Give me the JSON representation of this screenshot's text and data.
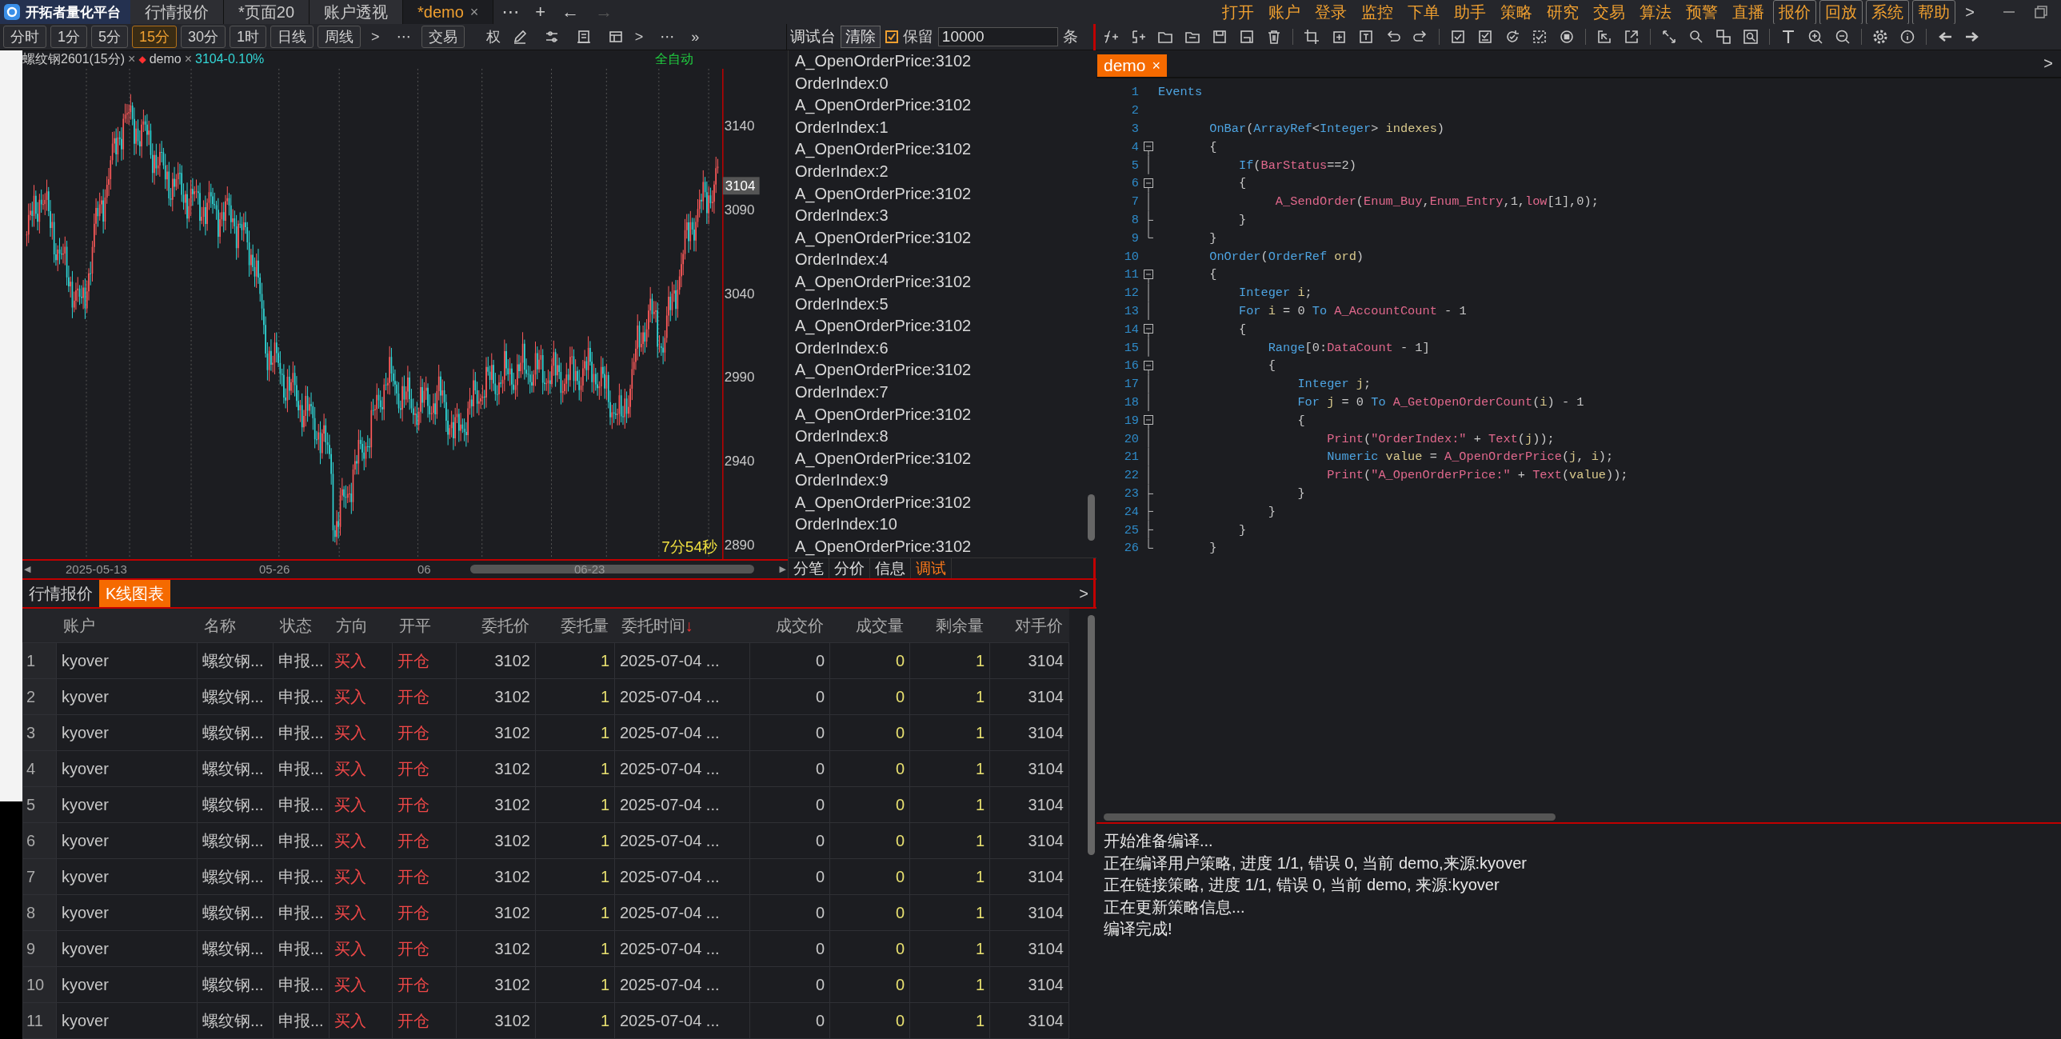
{
  "top_bar": {
    "logo": "开拓者量化平台",
    "tabs": [
      {
        "label": "行情报价",
        "selected": false
      },
      {
        "label": "*页面20",
        "selected": false
      },
      {
        "label": "账户透视",
        "selected": false
      },
      {
        "label": "*demo",
        "selected": true,
        "close": "×"
      }
    ],
    "tab_actions": [
      {
        "label": "⋯",
        "disabled": false
      },
      {
        "label": "+",
        "disabled": false
      },
      {
        "label": "←",
        "disabled": false
      },
      {
        "label": "→",
        "disabled": true
      }
    ],
    "menu": [
      {
        "label": "打开",
        "boxed": false
      },
      {
        "label": "账户",
        "boxed": false
      },
      {
        "label": "登录",
        "boxed": false
      },
      {
        "label": "监控",
        "boxed": false
      },
      {
        "label": "下单",
        "boxed": false
      },
      {
        "label": "助手",
        "boxed": false
      },
      {
        "label": "策略",
        "boxed": false
      },
      {
        "label": "研究",
        "boxed": false
      },
      {
        "label": "交易",
        "boxed": false
      },
      {
        "label": "算法",
        "boxed": false
      },
      {
        "label": "预警",
        "boxed": false
      },
      {
        "label": "直播",
        "boxed": false
      },
      {
        "label": "报价",
        "boxed": true
      },
      {
        "label": "回放",
        "boxed": true
      },
      {
        "label": "系统",
        "boxed": true
      },
      {
        "label": "帮助",
        "boxed": true
      }
    ],
    "menu_more": ">"
  },
  "chart_toolbar": {
    "periods": [
      {
        "label": "分时",
        "selected": false
      },
      {
        "label": "1分",
        "selected": false
      },
      {
        "label": "5分",
        "selected": false
      },
      {
        "label": "15分",
        "selected": true
      },
      {
        "label": "30分",
        "selected": false
      },
      {
        "label": "1时",
        "selected": false
      },
      {
        "label": "日线",
        "selected": false
      },
      {
        "label": "周线",
        "selected": false
      }
    ],
    "next": ">",
    "more": "⋯",
    "trade": "交易",
    "rights": "权",
    "next_2": ">",
    "more_2": "⋯",
    "expand": "»"
  },
  "chart": {
    "symbol": "螺纹钢2601(15分)",
    "close": "×",
    "strategy_mark": "◆",
    "strategy": "demo",
    "close_2": "×",
    "quote": "3104-0.10%",
    "mode": "全自动",
    "price_ticks": [
      "3140",
      "3090",
      "3040",
      "2990",
      "2940",
      "2890"
    ],
    "last_price": "3104",
    "countdown": "7分54秒",
    "scroll_left": "◀",
    "scroll_right": "▶",
    "date_ticks": [
      "2025-05-13",
      "05-26",
      "06",
      "06-23"
    ]
  },
  "debug": {
    "title": "调试台",
    "clear": "清除",
    "keep": {
      "label": "保留",
      "checked": true
    },
    "limit": "10000",
    "unit": "条",
    "lines": [
      "A_OpenOrderPrice:3102",
      "OrderIndex:0",
      "A_OpenOrderPrice:3102",
      "OrderIndex:1",
      "A_OpenOrderPrice:3102",
      "OrderIndex:2",
      "A_OpenOrderPrice:3102",
      "OrderIndex:3",
      "A_OpenOrderPrice:3102",
      "OrderIndex:4",
      "A_OpenOrderPrice:3102",
      "OrderIndex:5",
      "A_OpenOrderPrice:3102",
      "OrderIndex:6",
      "A_OpenOrderPrice:3102",
      "OrderIndex:7",
      "A_OpenOrderPrice:3102",
      "OrderIndex:8",
      "A_OpenOrderPrice:3102",
      "OrderIndex:9",
      "A_OpenOrderPrice:3102",
      "OrderIndex:10",
      "A_OpenOrderPrice:3102"
    ],
    "tabs": [
      {
        "label": "分笔",
        "selected": false
      },
      {
        "label": "分价",
        "selected": false
      },
      {
        "label": "信息",
        "selected": false
      },
      {
        "label": "调试",
        "selected": true
      }
    ]
  },
  "orders_panel": {
    "tabs": [
      {
        "label": "行情报价",
        "selected": false
      },
      {
        "label": "K线图表",
        "selected": true
      }
    ],
    "more": ">",
    "columns": [
      {
        "label": "账户",
        "color": "#c8c8c8"
      },
      {
        "label": "名称",
        "color": "#c8c8c8"
      },
      {
        "label": "状态",
        "color": "#c8c8c8"
      },
      {
        "label": "方向",
        "color": "#f04848"
      },
      {
        "label": "开平",
        "color": "#f04848"
      },
      {
        "label": "委托价",
        "color": "#c8c8c8"
      },
      {
        "label": "委托量",
        "color": "#e8e070"
      },
      {
        "label": "委托时间",
        "sort_mark": "↓",
        "color": "#c8c8c8"
      },
      {
        "label": "成交价",
        "color": "#c8c8c8"
      },
      {
        "label": "成交量",
        "color": "#e8e070"
      },
      {
        "label": "剩余量",
        "color": "#e8e070"
      },
      {
        "label": "对手价",
        "color": "#c8c8c8"
      }
    ],
    "rows": [
      {
        "index": "1",
        "cells": [
          "kyover",
          "螺纹钢...",
          "申报...",
          "买入",
          "开仓",
          "3102",
          "1",
          "2025-07-04 ...",
          "0",
          "0",
          "1",
          "3104"
        ]
      },
      {
        "index": "2",
        "cells": [
          "kyover",
          "螺纹钢...",
          "申报...",
          "买入",
          "开仓",
          "3102",
          "1",
          "2025-07-04 ...",
          "0",
          "0",
          "1",
          "3104"
        ]
      },
      {
        "index": "3",
        "cells": [
          "kyover",
          "螺纹钢...",
          "申报...",
          "买入",
          "开仓",
          "3102",
          "1",
          "2025-07-04 ...",
          "0",
          "0",
          "1",
          "3104"
        ]
      },
      {
        "index": "4",
        "cells": [
          "kyover",
          "螺纹钢...",
          "申报...",
          "买入",
          "开仓",
          "3102",
          "1",
          "2025-07-04 ...",
          "0",
          "0",
          "1",
          "3104"
        ]
      },
      {
        "index": "5",
        "cells": [
          "kyover",
          "螺纹钢...",
          "申报...",
          "买入",
          "开仓",
          "3102",
          "1",
          "2025-07-04 ...",
          "0",
          "0",
          "1",
          "3104"
        ]
      },
      {
        "index": "6",
        "cells": [
          "kyover",
          "螺纹钢...",
          "申报...",
          "买入",
          "开仓",
          "3102",
          "1",
          "2025-07-04 ...",
          "0",
          "0",
          "1",
          "3104"
        ]
      },
      {
        "index": "7",
        "cells": [
          "kyover",
          "螺纹钢...",
          "申报...",
          "买入",
          "开仓",
          "3102",
          "1",
          "2025-07-04 ...",
          "0",
          "0",
          "1",
          "3104"
        ]
      },
      {
        "index": "8",
        "cells": [
          "kyover",
          "螺纹钢...",
          "申报...",
          "买入",
          "开仓",
          "3102",
          "1",
          "2025-07-04 ...",
          "0",
          "0",
          "1",
          "3104"
        ]
      },
      {
        "index": "9",
        "cells": [
          "kyover",
          "螺纹钢...",
          "申报...",
          "买入",
          "开仓",
          "3102",
          "1",
          "2025-07-04 ...",
          "0",
          "0",
          "1",
          "3104"
        ]
      },
      {
        "index": "10",
        "cells": [
          "kyover",
          "螺纹钢...",
          "申报...",
          "买入",
          "开仓",
          "3102",
          "1",
          "2025-07-04 ...",
          "0",
          "0",
          "1",
          "3104"
        ]
      },
      {
        "index": "11",
        "cells": [
          "kyover",
          "螺纹钢...",
          "申报...",
          "买入",
          "开仓",
          "3102",
          "1",
          "2025-07-04 ...",
          "0",
          "0",
          "1",
          "3104"
        ]
      }
    ]
  },
  "editor": {
    "tab": {
      "label": "demo",
      "close": "×"
    },
    "more": ">",
    "lines": [
      {
        "number": "1",
        "kind": "none",
        "tokens": [
          {
            "text": "Events",
            "kind": "kw"
          }
        ]
      },
      {
        "number": "2",
        "kind": "none"
      },
      {
        "number": "3",
        "kind": "none",
        "tokens": [
          {
            "text": "       OnBar",
            "kind": "kw"
          },
          {
            "text": "(",
            "kind": "p"
          },
          {
            "text": "ArrayRef",
            "kind": "kw"
          },
          {
            "text": "<",
            "kind": "p"
          },
          {
            "text": "Integer",
            "kind": "kw"
          },
          {
            "text": "> ",
            "kind": "p"
          },
          {
            "text": "indexes",
            "kind": "var"
          },
          {
            "text": ")",
            "kind": "p"
          }
        ]
      },
      {
        "number": "4",
        "kind": "start",
        "tokens": [
          {
            "text": "       {",
            "kind": "p"
          }
        ]
      },
      {
        "number": "5",
        "kind": "mid",
        "tokens": [
          {
            "text": "           If",
            "kind": "kw"
          },
          {
            "text": "(",
            "kind": "p"
          },
          {
            "text": "BarStatus",
            "kind": "fn"
          },
          {
            "text": "==2)",
            "kind": "p"
          }
        ]
      },
      {
        "number": "6",
        "kind": "start",
        "tokens": [
          {
            "text": "           {",
            "kind": "p"
          }
        ]
      },
      {
        "number": "7",
        "kind": "mid",
        "tokens": [
          {
            "text": "                A_SendOrder",
            "kind": "fn"
          },
          {
            "text": "(",
            "kind": "p"
          },
          {
            "text": "Enum_Buy",
            "kind": "fn"
          },
          {
            "text": ",",
            "kind": "p"
          },
          {
            "text": "Enum_Entry",
            "kind": "fn"
          },
          {
            "text": ",1,",
            "kind": "p"
          },
          {
            "text": "low",
            "kind": "fn"
          },
          {
            "text": "[1],0);",
            "kind": "p"
          }
        ]
      },
      {
        "number": "8",
        "kind": "branch",
        "tokens": [
          {
            "text": "           }",
            "kind": "p"
          }
        ]
      },
      {
        "number": "9",
        "kind": "last",
        "tokens": [
          {
            "text": "       }",
            "kind": "p"
          }
        ]
      },
      {
        "number": "10",
        "kind": "none",
        "tokens": [
          {
            "text": "       OnOrder",
            "kind": "kw"
          },
          {
            "text": "(",
            "kind": "p"
          },
          {
            "text": "OrderRef",
            "kind": "kw"
          },
          {
            "text": " ord",
            "kind": "var"
          },
          {
            "text": ")",
            "kind": "p"
          }
        ]
      },
      {
        "number": "11",
        "kind": "start",
        "tokens": [
          {
            "text": "       {",
            "kind": "p"
          }
        ]
      },
      {
        "number": "12",
        "kind": "mid",
        "tokens": [
          {
            "text": "           Integer",
            "kind": "kw"
          },
          {
            "text": " i",
            "kind": "var"
          },
          {
            "text": ";",
            "kind": "p"
          }
        ]
      },
      {
        "number": "13",
        "kind": "mid",
        "tokens": [
          {
            "text": "           For",
            "kind": "kw"
          },
          {
            "text": " i",
            "kind": "var"
          },
          {
            "text": " = 0 ",
            "kind": "p"
          },
          {
            "text": "To",
            "kind": "kw"
          },
          {
            "text": " A_AccountCount",
            "kind": "fn"
          },
          {
            "text": " - 1",
            "kind": "p"
          }
        ]
      },
      {
        "number": "14",
        "kind": "start",
        "tokens": [
          {
            "text": "           {",
            "kind": "p"
          }
        ]
      },
      {
        "number": "15",
        "kind": "mid",
        "tokens": [
          {
            "text": "               Range",
            "kind": "kw"
          },
          {
            "text": "[0:",
            "kind": "p"
          },
          {
            "text": "DataCount",
            "kind": "fn"
          },
          {
            "text": " - 1]",
            "kind": "p"
          }
        ]
      },
      {
        "number": "16",
        "kind": "start",
        "tokens": [
          {
            "text": "               {",
            "kind": "p"
          }
        ]
      },
      {
        "number": "17",
        "kind": "mid",
        "tokens": [
          {
            "text": "                   Integer",
            "kind": "kw"
          },
          {
            "text": " j",
            "kind": "var"
          },
          {
            "text": ";",
            "kind": "p"
          }
        ]
      },
      {
        "number": "18",
        "kind": "mid",
        "tokens": [
          {
            "text": "                   For",
            "kind": "kw"
          },
          {
            "text": " j",
            "kind": "var"
          },
          {
            "text": " = 0 ",
            "kind": "p"
          },
          {
            "text": "To",
            "kind": "kw"
          },
          {
            "text": " A_GetOpenOrderCount",
            "kind": "fn"
          },
          {
            "text": "(",
            "kind": "p"
          },
          {
            "text": "i",
            "kind": "var"
          },
          {
            "text": ") - 1",
            "kind": "p"
          }
        ]
      },
      {
        "number": "19",
        "kind": "start",
        "tokens": [
          {
            "text": "                   {",
            "kind": "p"
          }
        ]
      },
      {
        "number": "20",
        "kind": "mid",
        "tokens": [
          {
            "text": "                       Print",
            "kind": "fn"
          },
          {
            "text": "(",
            "kind": "p"
          },
          {
            "text": "\"OrderIndex:\"",
            "kind": "str"
          },
          {
            "text": " + ",
            "kind": "p"
          },
          {
            "text": "Text",
            "kind": "fn"
          },
          {
            "text": "(",
            "kind": "p"
          },
          {
            "text": "j",
            "kind": "var"
          },
          {
            "text": "));",
            "kind": "p"
          }
        ]
      },
      {
        "number": "21",
        "kind": "mid",
        "tokens": [
          {
            "text": "                       Numeric",
            "kind": "kw"
          },
          {
            "text": " value",
            "kind": "var"
          },
          {
            "text": " = ",
            "kind": "p"
          },
          {
            "text": "A_OpenOrderPrice",
            "kind": "fn"
          },
          {
            "text": "(",
            "kind": "p"
          },
          {
            "text": "j",
            "kind": "var"
          },
          {
            "text": ", ",
            "kind": "p"
          },
          {
            "text": "i",
            "kind": "var"
          },
          {
            "text": ");",
            "kind": "p"
          }
        ]
      },
      {
        "number": "22",
        "kind": "mid",
        "tokens": [
          {
            "text": "                       Print",
            "kind": "fn"
          },
          {
            "text": "(",
            "kind": "p"
          },
          {
            "text": "\"A_OpenOrderPrice:\"",
            "kind": "str"
          },
          {
            "text": " + ",
            "kind": "p"
          },
          {
            "text": "Text",
            "kind": "fn"
          },
          {
            "text": "(",
            "kind": "p"
          },
          {
            "text": "value",
            "kind": "var"
          },
          {
            "text": "));",
            "kind": "p"
          }
        ]
      },
      {
        "number": "23",
        "kind": "branch",
        "tokens": [
          {
            "text": "                   }",
            "kind": "p"
          }
        ]
      },
      {
        "number": "24",
        "kind": "branch",
        "tokens": [
          {
            "text": "               }",
            "kind": "p"
          }
        ]
      },
      {
        "number": "25",
        "kind": "branch",
        "tokens": [
          {
            "text": "           }",
            "kind": "p"
          }
        ]
      },
      {
        "number": "26",
        "kind": "last",
        "tokens": [
          {
            "text": "       }",
            "kind": "p"
          }
        ]
      }
    ],
    "output": [
      "开始准备编译...",
      "正在编译用户策略, 进度 1/1, 错误 0, 当前 demo,来源:kyover",
      "正在链接策略, 进度 1/1, 错误 0, 当前 demo, 来源:kyover",
      "正在更新策略信息...",
      "编译完成!"
    ]
  }
}
